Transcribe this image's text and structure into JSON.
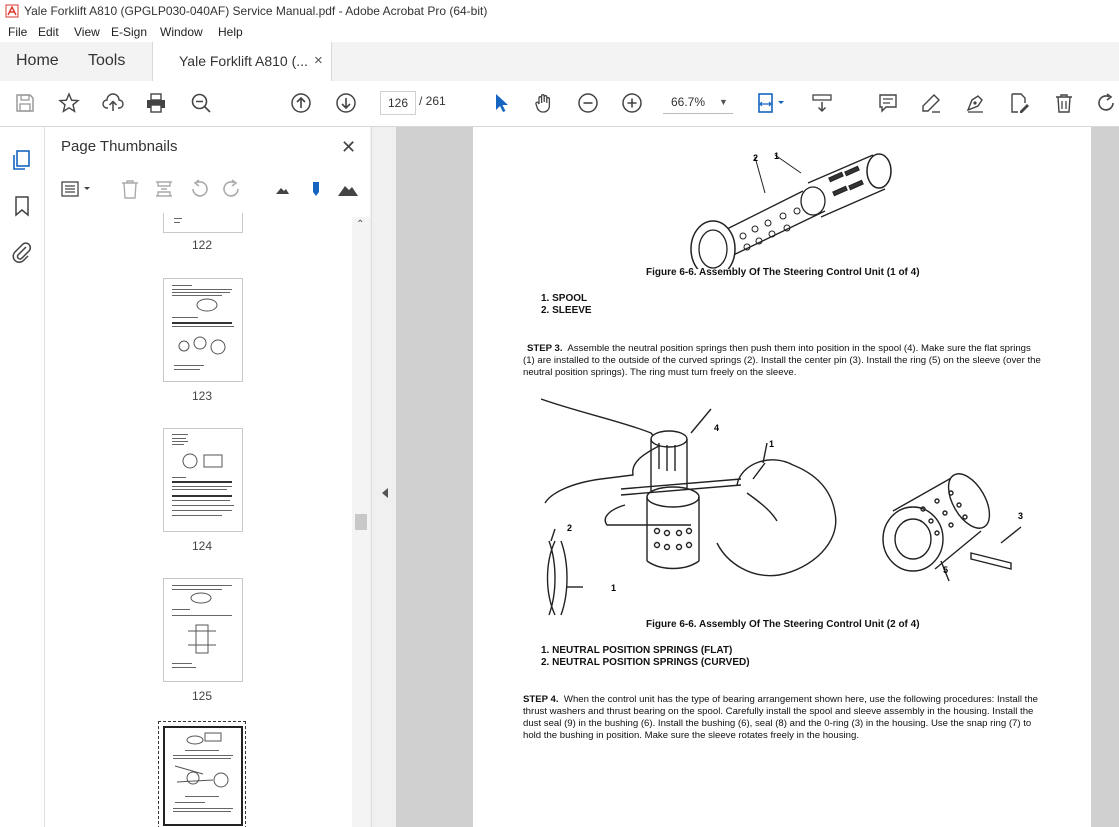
{
  "window": {
    "title": "Yale Forklift A810 (GPGLP030-040AF) Service Manual.pdf - Adobe Acrobat Pro (64-bit)"
  },
  "menu": [
    "File",
    "Edit",
    "View",
    "E-Sign",
    "Window",
    "Help"
  ],
  "tabs": {
    "home": "Home",
    "tools": "Tools",
    "doc": "Yale Forklift A810 (...",
    "close": "×"
  },
  "toolbar": {
    "page_current": "126",
    "page_total": "/ 261",
    "zoom": "66.7%"
  },
  "sidebar": {
    "title": "Page Thumbnails",
    "close": "✕",
    "thumb_labels": [
      "122",
      "123",
      "124",
      "125"
    ]
  },
  "document": {
    "fig1": {
      "callouts": [
        "1",
        "2"
      ],
      "caption": "Figure 6-6. Assembly Of The Steering Control Unit (1 of 4)",
      "items": [
        "1.   SPOOL",
        "2.   SLEEVE"
      ]
    },
    "step3": {
      "label": "STEP 3.",
      "text": "Assemble the neutral position springs then push them into position in the spool (4). Make sure the flat springs (1) are installed to the outside of the curved springs (2). Install the center pin (3). Install the ring (5) on the sleeve (over the neutral position springs). The ring must turn freely on the sleeve."
    },
    "fig2": {
      "callouts": [
        "4",
        "1",
        "2",
        "1",
        "3",
        "5"
      ],
      "caption": "Figure 6-6. Assembly Of The Steering Control Unit (2 of 4)",
      "items": [
        "1.   NEUTRAL POSITION SPRINGS (FLAT)",
        "2.   NEUTRAL POSITION SPRINGS (CURVED)"
      ]
    },
    "step4": {
      "label": "STEP 4.",
      "text": "When the control unit has the type of bearing arrangement shown here, use the following procedures: Install the thrust washers and thrust bearing on the spool. Carefully install the spool and sleeve assembly in the housing. Install the dust seal (9) in the bushing (6). Install the bushing (6), seal (8) and the 0-ring (3) in the housing. Use the snap ring (7) to hold the bushing in position. Make sure the sleeve rotates freely in the housing."
    }
  }
}
